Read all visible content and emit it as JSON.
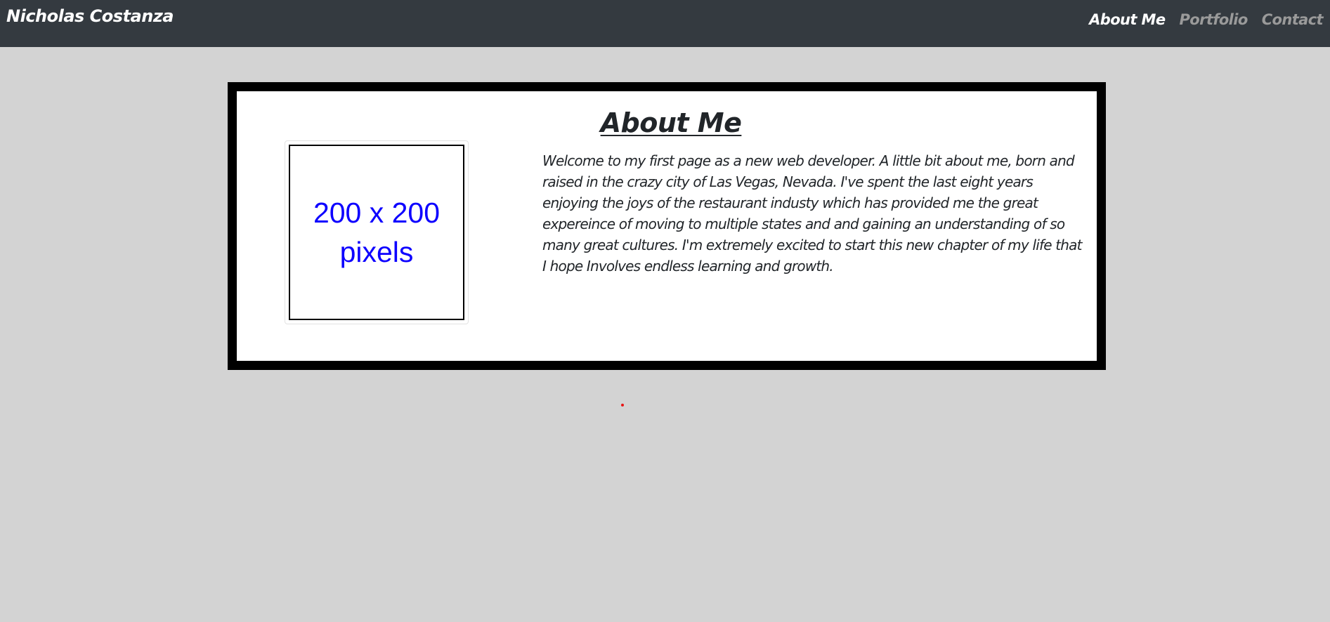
{
  "navbar": {
    "brand": "Nicholas Costanza",
    "links": [
      {
        "label": "About Me",
        "active": true
      },
      {
        "label": "Portfolio",
        "active": false
      },
      {
        "label": "Contact",
        "active": false
      }
    ]
  },
  "main": {
    "heading": "About Me",
    "image": {
      "line1": "200 x 200",
      "line2": "pixels"
    },
    "bio": "Welcome to my first page as a new web developer. A little bit about me, born and raised in the crazy city of Las Vegas, Nevada. I've spent the last eight years enjoying the joys of the restaurant industy which has provided me the great expereince of moving to multiple states and and gaining an understanding of so many great cultures. I'm extremely excited to start this new chapter of my life that I hope Involves endless learning and growth."
  },
  "colors": {
    "navbar_bg": "#343a40",
    "page_bg": "#d3d3d3",
    "card_border": "#000000",
    "placeholder_text": "#0d00ff",
    "inactive_link": "#9a9a9a"
  }
}
